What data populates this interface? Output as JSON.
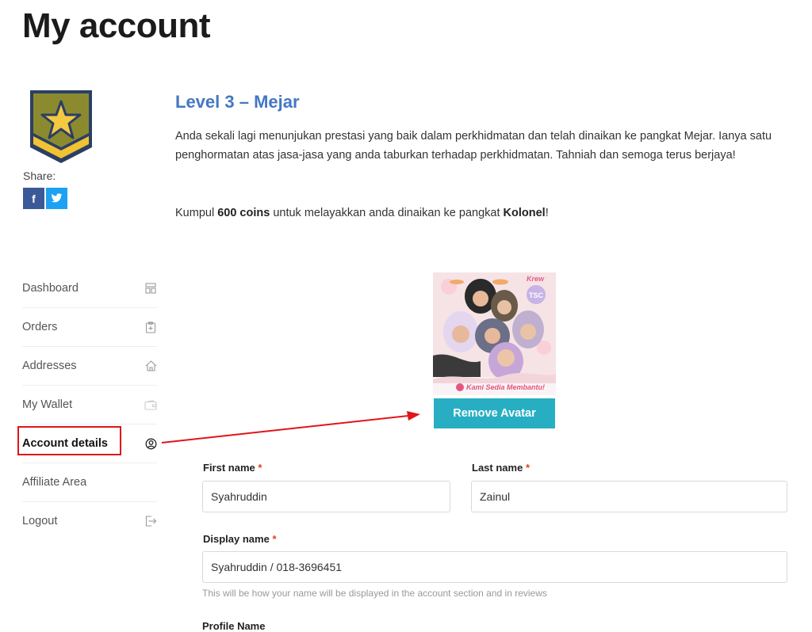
{
  "page": {
    "title": "My account"
  },
  "share": {
    "label": "Share:",
    "facebook_glyph": "f",
    "twitter_glyph": "t"
  },
  "level": {
    "title": "Level 3 – Mejar",
    "description": "Anda sekali lagi menunjukan prestasi yang baik dalam perkhidmatan dan telah dinaikan ke pangkat Mejar. Ianya satu penghormatan atas jasa-jasa yang anda taburkan terhadap perkhidmatan. Tahniah dan semoga terus berjaya!",
    "coins_prefix": "Kumpul ",
    "coins_amount": "600 coins",
    "coins_middle": " untuk melayakkan anda dinaikan ke pangkat ",
    "next_rank": "Kolonel",
    "coins_suffix": "!"
  },
  "nav": {
    "items": [
      {
        "label": "Dashboard",
        "icon": "dashboard-icon"
      },
      {
        "label": "Orders",
        "icon": "clipboard-icon"
      },
      {
        "label": "Addresses",
        "icon": "home-icon"
      },
      {
        "label": "My Wallet",
        "icon": "wallet-icon"
      },
      {
        "label": "Account details",
        "icon": "user-circle-icon",
        "active": true
      },
      {
        "label": "Affiliate Area",
        "icon": ""
      },
      {
        "label": "Logout",
        "icon": "logout-icon"
      }
    ]
  },
  "avatar": {
    "caption": "Kami Sedia Membantu!",
    "badge_text": "TSC",
    "remove_label": "Remove Avatar"
  },
  "form": {
    "first_name": {
      "label": "First name",
      "required": "*",
      "value": "Syahruddin"
    },
    "last_name": {
      "label": "Last name",
      "required": "*",
      "value": "Zainul"
    },
    "display_name": {
      "label": "Display name",
      "required": "*",
      "value": "Syahruddin / 018-3696451",
      "help": "This will be how your name will be displayed in the account section and in reviews"
    },
    "next_field_label": "Profile Name"
  },
  "colors": {
    "accent": "#4477c4",
    "button": "#28aec3",
    "highlight": "#e0141a"
  }
}
